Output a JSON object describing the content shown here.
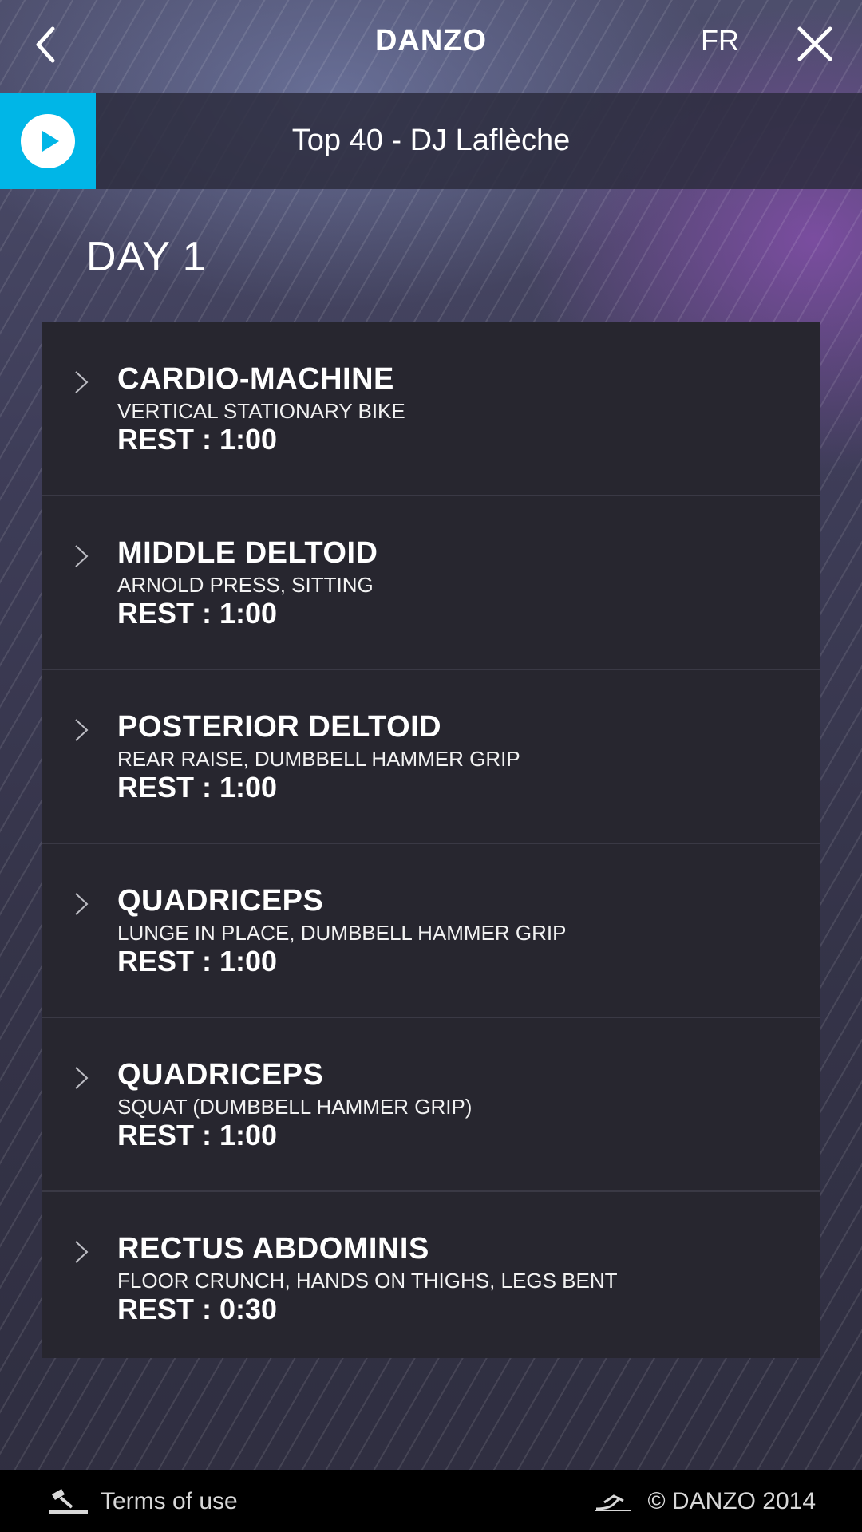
{
  "header": {
    "title": "DANZO",
    "language": "FR"
  },
  "player": {
    "track": "Top 40 - DJ Laflèche"
  },
  "day_title": "DAY 1",
  "exercises": [
    {
      "muscle": "CARDIO-MACHINE",
      "exercise": "VERTICAL STATIONARY BIKE",
      "rest": "REST : 1:00"
    },
    {
      "muscle": "MIDDLE DELTOID",
      "exercise": "ARNOLD PRESS, SITTING",
      "rest": "REST : 1:00"
    },
    {
      "muscle": "POSTERIOR DELTOID",
      "exercise": "REAR RAISE, DUMBBELL HAMMER GRIP",
      "rest": "REST : 1:00"
    },
    {
      "muscle": "QUADRICEPS",
      "exercise": "LUNGE IN PLACE, DUMBBELL HAMMER GRIP",
      "rest": "REST : 1:00"
    },
    {
      "muscle": "QUADRICEPS",
      "exercise": "SQUAT (DUMBBELL HAMMER GRIP)",
      "rest": "REST : 1:00"
    },
    {
      "muscle": "RECTUS ABDOMINIS",
      "exercise": "FLOOR CRUNCH, HANDS ON THIGHS, LEGS BENT",
      "rest": "REST : 0:30"
    }
  ],
  "footer": {
    "terms": "Terms of use",
    "copyright": "© DANZO 2014"
  },
  "colors": {
    "accent": "#00b6e7",
    "list_bg": "#27262f",
    "footer_bg": "#000000"
  },
  "icons": {
    "back": "back-arrow-icon",
    "close": "close-icon",
    "play": "play-icon",
    "chevron": "chevron-right-icon",
    "gavel": "gavel-icon",
    "runner": "runner-logo-icon"
  }
}
